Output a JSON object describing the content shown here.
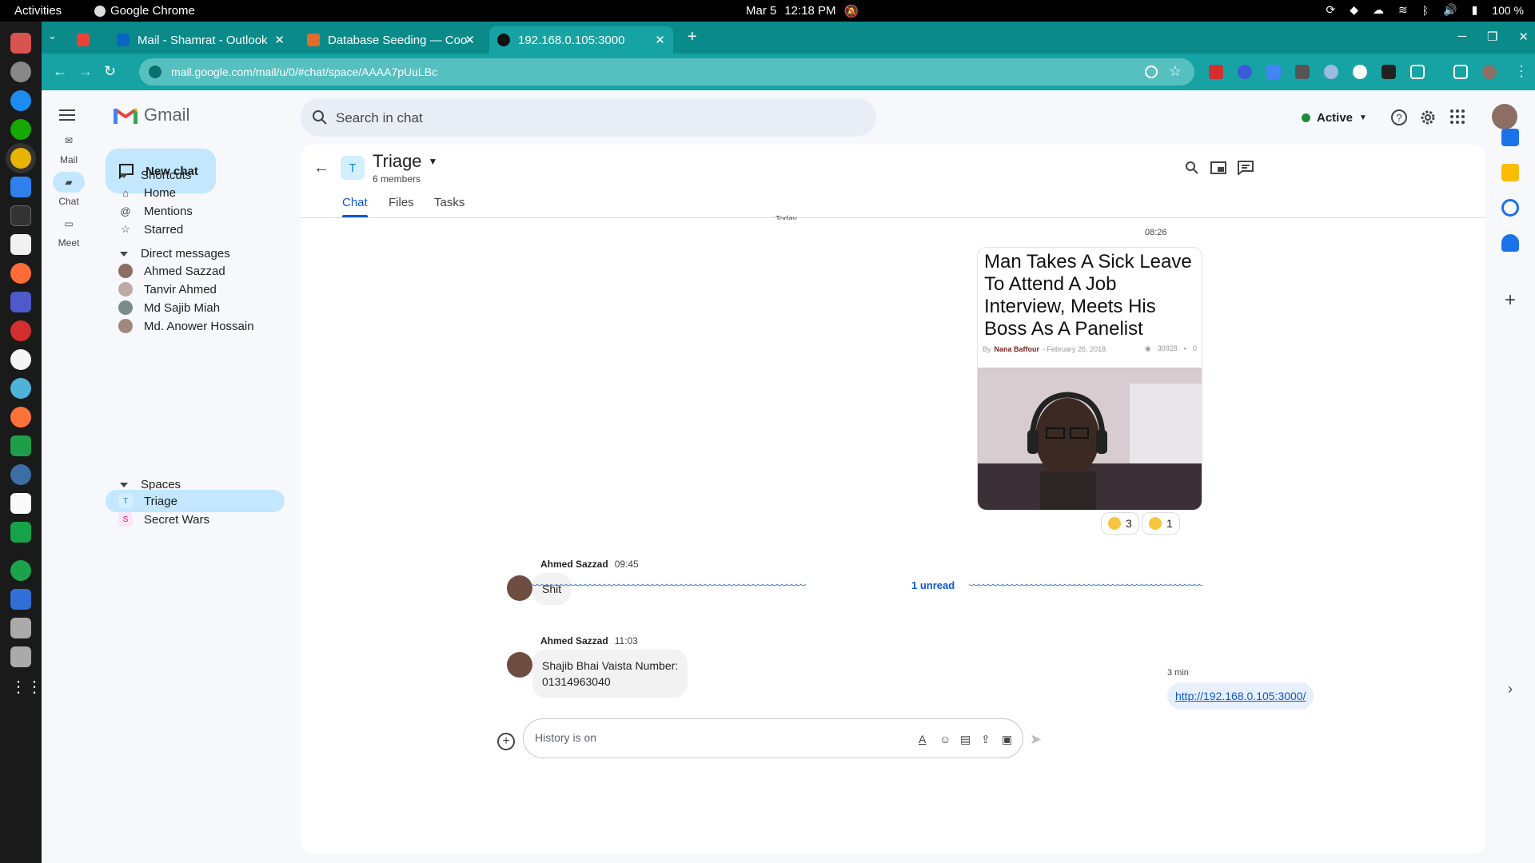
{
  "os": {
    "activities": "Activities",
    "app_name": "Google Chrome",
    "date": "Mar 5",
    "time": "12:18 PM",
    "battery": "100 %"
  },
  "tabs": [
    {
      "title": "Mail - Shamrat - Outlook",
      "favicon_color": "#0a64c2"
    },
    {
      "title": "Database Seeding — Coo",
      "favicon_color": "#e06c2a"
    },
    {
      "title": "192.168.0.105:3000",
      "favicon_color": "#111111"
    }
  ],
  "browser": {
    "url": "mail.google.com/mail/u/0/#chat/space/AAAA7pUuLBc",
    "accent": "#17a3a3",
    "tab_strip": "#0b8a8a"
  },
  "gmail": {
    "brand": "Gmail",
    "search_placeholder": "Search in chat",
    "status": "Active"
  },
  "rail": [
    {
      "label": "Mail",
      "icon": "mail-icon"
    },
    {
      "label": "Chat",
      "icon": "chat-icon"
    },
    {
      "label": "Meet",
      "icon": "video-icon"
    }
  ],
  "sidebar": {
    "new_chat": "New chat",
    "shortcuts_title": "Shortcuts",
    "shortcuts": [
      {
        "label": "Home",
        "icon": "home-icon"
      },
      {
        "label": "Mentions",
        "icon": "at-icon"
      },
      {
        "label": "Starred",
        "icon": "star-icon"
      }
    ],
    "dm_title": "Direct messages",
    "dms": [
      {
        "label": "Ahmed Sazzad"
      },
      {
        "label": "Tanvir Ahmed"
      },
      {
        "label": "Md Sajib Miah"
      },
      {
        "label": "Md. Anower Hossain"
      }
    ],
    "spaces_title": "Spaces",
    "spaces": [
      {
        "label": "Triage",
        "letter": "T",
        "active": true
      },
      {
        "label": "Secret Wars",
        "letter": "S",
        "active": false
      }
    ]
  },
  "space": {
    "name": "Triage",
    "letter": "T",
    "members": "6 members",
    "tabs": [
      "Chat",
      "Files",
      "Tasks"
    ],
    "active_tab": "Chat"
  },
  "messages": {
    "today": "Today",
    "card_time": "08:26",
    "card": {
      "headline": "Man Takes A Sick Leave To Attend A Job Interview, Meets His Boss As A Panelist",
      "by": "By",
      "author": "Nana Baffour",
      "date": "- February 26, 2018",
      "views": "30928",
      "comments": "0"
    },
    "reactions": [
      {
        "emoji": "rofl",
        "count": "3"
      },
      {
        "emoji": "laughing",
        "count": "1"
      }
    ],
    "msg1": {
      "sender": "Ahmed Sazzad",
      "time": "09:45",
      "text": "Shit"
    },
    "unread": "1 unread",
    "msg2": {
      "sender": "Ahmed Sazzad",
      "time": "11:03",
      "line1": "Shajib Bhai Vaista Number:",
      "line2": "01314963040"
    },
    "link_time": "3 min",
    "link": "http://192.168.0.105:3000/"
  },
  "composer": {
    "placeholder": "History is on"
  }
}
